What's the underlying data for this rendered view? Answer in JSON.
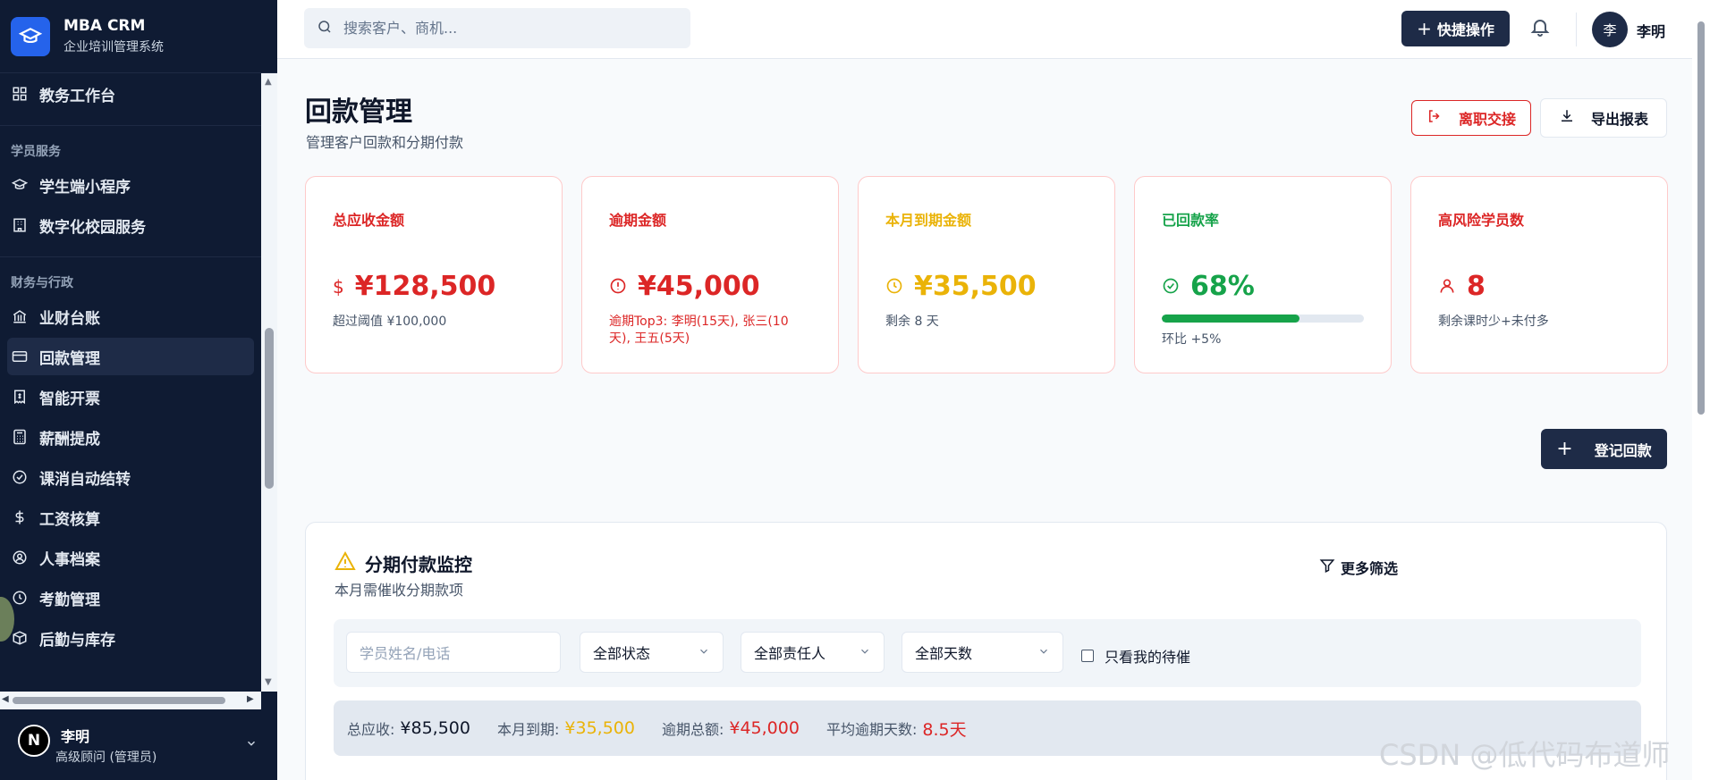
{
  "brand": {
    "title": "MBA CRM",
    "subtitle": "企业培训管理系统"
  },
  "sidebar": {
    "items_top": [
      {
        "label": "教务工作台",
        "icon": "grid-icon"
      }
    ],
    "section_student": "学员服务",
    "items_student": [
      {
        "label": "学生端小程序",
        "icon": "graduation-cap-icon"
      },
      {
        "label": "数字化校园服务",
        "icon": "building-icon"
      }
    ],
    "section_finance": "财务与行政",
    "items_finance": [
      {
        "label": "业财台账",
        "icon": "bank-icon"
      },
      {
        "label": "回款管理",
        "icon": "credit-card-icon",
        "active": true
      },
      {
        "label": "智能开票",
        "icon": "receipt-icon"
      },
      {
        "label": "薪酬提成",
        "icon": "calculator-icon"
      },
      {
        "label": "课消自动结转",
        "icon": "check-circle-icon"
      },
      {
        "label": "工资核算",
        "icon": "dollar-icon"
      },
      {
        "label": "人事档案",
        "icon": "user-circle-icon"
      },
      {
        "label": "考勤管理",
        "icon": "clock-icon"
      },
      {
        "label": "后勤与库存",
        "icon": "box-icon"
      }
    ],
    "user": {
      "avatar": "N",
      "name": "李明",
      "role": "高级顾问 (管理员)"
    }
  },
  "topbar": {
    "search_placeholder": "搜索客户、商机...",
    "quick_action": "快捷操作",
    "avatar": "李",
    "user_name": "李明"
  },
  "page": {
    "title": "回款管理",
    "subtitle": "管理客户回款和分期付款",
    "btn_handover": "离职交接",
    "btn_export": "导出报表",
    "btn_register": "登记回款"
  },
  "cards": [
    {
      "label": "总应收金额",
      "value": "¥128,500",
      "note": "超过阈值 ¥100,000",
      "color": "#dc2626",
      "note_color": "#475569",
      "icon": "dollar-icon"
    },
    {
      "label": "逾期金额",
      "value": "¥45,000",
      "note": "逾期Top3: 李明(15天), 张三(10天), 王五(5天)",
      "color": "#dc2626",
      "note_color": "#dc2626",
      "icon": "alert-circle-icon"
    },
    {
      "label": "本月到期金额",
      "value": "¥35,500",
      "note": "剩余 8 天",
      "color": "#eab308",
      "note_color": "#475569",
      "icon": "clock-icon"
    },
    {
      "label": "已回款率",
      "value": "68%",
      "note": "环比 +5%",
      "color": "#16a34a",
      "note_color": "#475569",
      "icon": "check-circle-icon",
      "progress": 0.68
    },
    {
      "label": "高风险学员数",
      "value": "8",
      "note": "剩余课时少+未付多",
      "color": "#dc2626",
      "note_color": "#475569",
      "icon": "user-icon"
    }
  ],
  "panel": {
    "title": "分期付款监控",
    "subtitle": "本月需催收分期款项",
    "more_filter": "更多筛选",
    "filters": {
      "name_placeholder": "学员姓名/电话",
      "status": "全部状态",
      "owner": "全部责任人",
      "days": "全部天数",
      "mine_only": "只看我的待催"
    },
    "summary": [
      {
        "label": "总应收:",
        "value": "¥85,500",
        "color": "#0f172a"
      },
      {
        "label": "本月到期:",
        "value": "¥35,500",
        "color": "#eab308"
      },
      {
        "label": "逾期总额:",
        "value": "¥45,000",
        "color": "#dc2626"
      },
      {
        "label": "平均逾期天数:",
        "value": "8.5天",
        "color": "#dc2626"
      }
    ]
  },
  "watermark": "CSDN @低代码布道师"
}
